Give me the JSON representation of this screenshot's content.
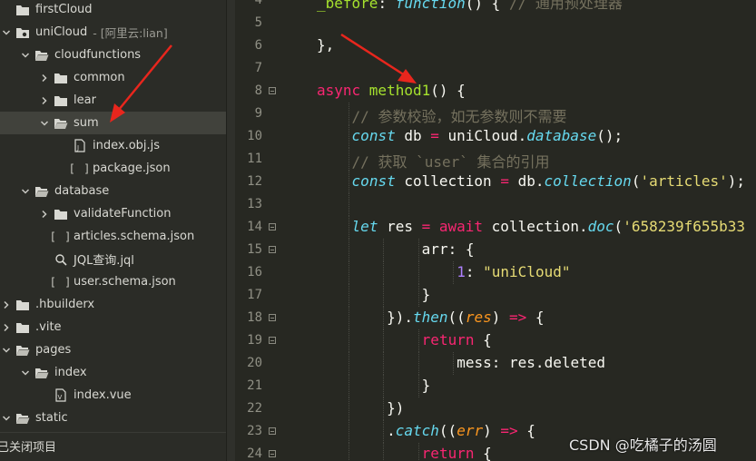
{
  "sidebar": {
    "tree": [
      {
        "label": "firstCloud",
        "sub": "",
        "depth": 0,
        "twisty": "none",
        "icon": "project-icon",
        "selected": false
      },
      {
        "label": "uniCloud",
        "sub": "- [阿里云:lian]",
        "depth": 0,
        "twisty": "down",
        "icon": "cloud-folder-icon",
        "selected": false
      },
      {
        "label": "cloudfunctions",
        "sub": "",
        "depth": 1,
        "twisty": "down",
        "icon": "folder-open-icon",
        "selected": false
      },
      {
        "label": "common",
        "sub": "",
        "depth": 2,
        "twisty": "right",
        "icon": "folder-icon",
        "selected": false
      },
      {
        "label": "lear",
        "sub": "",
        "depth": 2,
        "twisty": "right",
        "icon": "folder-icon",
        "selected": false
      },
      {
        "label": "sum",
        "sub": "",
        "depth": 2,
        "twisty": "down",
        "icon": "folder-open-icon",
        "selected": true
      },
      {
        "label": "index.obj.js",
        "sub": "",
        "depth": 3,
        "twisty": "none",
        "icon": "js-file-icon",
        "selected": false
      },
      {
        "label": "package.json",
        "sub": "",
        "depth": 3,
        "twisty": "none",
        "icon": "json-file-icon",
        "selected": false
      },
      {
        "label": "database",
        "sub": "",
        "depth": 1,
        "twisty": "down",
        "icon": "folder-open-icon",
        "selected": false
      },
      {
        "label": "validateFunction",
        "sub": "",
        "depth": 2,
        "twisty": "right",
        "icon": "folder-icon",
        "selected": false
      },
      {
        "label": "articles.schema.json",
        "sub": "",
        "depth": 2,
        "twisty": "none",
        "icon": "json-file-icon",
        "selected": false
      },
      {
        "label": "JQL查询.jql",
        "sub": "",
        "depth": 2,
        "twisty": "none",
        "icon": "jql-file-icon",
        "selected": false
      },
      {
        "label": "user.schema.json",
        "sub": "",
        "depth": 2,
        "twisty": "none",
        "icon": "json-file-icon",
        "selected": false
      },
      {
        "label": ".hbuilderx",
        "sub": "",
        "depth": 0,
        "twisty": "right",
        "icon": "folder-icon",
        "selected": false
      },
      {
        "label": ".vite",
        "sub": "",
        "depth": 0,
        "twisty": "right",
        "icon": "folder-icon",
        "selected": false
      },
      {
        "label": "pages",
        "sub": "",
        "depth": 0,
        "twisty": "down",
        "icon": "folder-open-icon",
        "selected": false
      },
      {
        "label": "index",
        "sub": "",
        "depth": 1,
        "twisty": "down",
        "icon": "folder-open-icon",
        "selected": false
      },
      {
        "label": "index.vue",
        "sub": "",
        "depth": 2,
        "twisty": "none",
        "icon": "vue-file-icon",
        "selected": false
      },
      {
        "label": "static",
        "sub": "",
        "depth": 0,
        "twisty": "down",
        "icon": "folder-open-icon",
        "selected": false
      }
    ],
    "closed_projects": "已关闭项目"
  },
  "editor": {
    "lines": [
      {
        "n": "4",
        "fold": false,
        "indent": 1,
        "tokens": [
          [
            "fn",
            "_before"
          ],
          [
            "pl",
            ": "
          ],
          [
            "kwi",
            "function"
          ],
          [
            "pl",
            "() { "
          ],
          [
            "cm",
            "// 通用预处理器"
          ]
        ]
      },
      {
        "n": "5",
        "fold": false,
        "indent": 1,
        "tokens": []
      },
      {
        "n": "6",
        "fold": false,
        "indent": 1,
        "tokens": [
          [
            "pl",
            "},"
          ]
        ]
      },
      {
        "n": "7",
        "fold": false,
        "indent": 1,
        "tokens": []
      },
      {
        "n": "8",
        "fold": true,
        "indent": 1,
        "tokens": [
          [
            "kw",
            "async "
          ],
          [
            "fn",
            "method1"
          ],
          [
            "pl",
            "() {"
          ]
        ]
      },
      {
        "n": "9",
        "fold": false,
        "indent": 2,
        "tokens": [
          [
            "cm",
            "// 参数校验，如无参数则不需要"
          ]
        ]
      },
      {
        "n": "10",
        "fold": false,
        "indent": 2,
        "tokens": [
          [
            "kwi",
            "const "
          ],
          [
            "pl",
            "db "
          ],
          [
            "kw",
            "= "
          ],
          [
            "pl",
            "uniCloud."
          ],
          [
            "kwi",
            "database"
          ],
          [
            "pl",
            "();"
          ]
        ]
      },
      {
        "n": "11",
        "fold": false,
        "indent": 2,
        "tokens": [
          [
            "cm",
            "// 获取 `user` 集合的引用"
          ]
        ]
      },
      {
        "n": "12",
        "fold": false,
        "indent": 2,
        "tokens": [
          [
            "kwi",
            "const "
          ],
          [
            "pl",
            "collection "
          ],
          [
            "kw",
            "= "
          ],
          [
            "pl",
            "db."
          ],
          [
            "kwi",
            "collection"
          ],
          [
            "pl",
            "("
          ],
          [
            "st",
            "'articles'"
          ],
          [
            "pl",
            ");"
          ]
        ]
      },
      {
        "n": "13",
        "fold": false,
        "indent": 2,
        "tokens": []
      },
      {
        "n": "14",
        "fold": true,
        "indent": 2,
        "tokens": [
          [
            "kwi",
            "let "
          ],
          [
            "pl",
            "res "
          ],
          [
            "kw",
            "= await "
          ],
          [
            "pl",
            "collection."
          ],
          [
            "kwi",
            "doc"
          ],
          [
            "pl",
            "("
          ],
          [
            "st",
            "'658239f655b33"
          ]
        ]
      },
      {
        "n": "15",
        "fold": true,
        "indent": 4,
        "tokens": [
          [
            "pl",
            "arr: {"
          ]
        ]
      },
      {
        "n": "16",
        "fold": false,
        "indent": 5,
        "tokens": [
          [
            "nm",
            "1"
          ],
          [
            "pl",
            ": "
          ],
          [
            "st",
            "\"uniCloud\""
          ]
        ]
      },
      {
        "n": "17",
        "fold": false,
        "indent": 4,
        "tokens": [
          [
            "pl",
            "}"
          ]
        ]
      },
      {
        "n": "18",
        "fold": true,
        "indent": 3,
        "tokens": [
          [
            "pl",
            "})."
          ],
          [
            "kwi",
            "then"
          ],
          [
            "pl",
            "(("
          ],
          [
            "pm",
            "res"
          ],
          [
            "pl",
            ") "
          ],
          [
            "kw",
            "=> "
          ],
          [
            "pl",
            "{"
          ]
        ]
      },
      {
        "n": "19",
        "fold": true,
        "indent": 4,
        "tokens": [
          [
            "kw",
            "return "
          ],
          [
            "pl",
            "{"
          ]
        ]
      },
      {
        "n": "20",
        "fold": false,
        "indent": 5,
        "tokens": [
          [
            "pl",
            "mess: res.deleted"
          ]
        ]
      },
      {
        "n": "21",
        "fold": false,
        "indent": 4,
        "tokens": [
          [
            "pl",
            "}"
          ]
        ]
      },
      {
        "n": "22",
        "fold": false,
        "indent": 3,
        "tokens": [
          [
            "pl",
            "})"
          ]
        ]
      },
      {
        "n": "23",
        "fold": true,
        "indent": 3,
        "tokens": [
          [
            "pl",
            "."
          ],
          [
            "kwi",
            "catch"
          ],
          [
            "pl",
            "(("
          ],
          [
            "pm",
            "err"
          ],
          [
            "pl",
            ") "
          ],
          [
            "kw",
            "=> "
          ],
          [
            "pl",
            "{"
          ]
        ]
      },
      {
        "n": "24",
        "fold": true,
        "indent": 4,
        "tokens": [
          [
            "kw",
            "return "
          ],
          [
            "pl",
            "{"
          ]
        ]
      }
    ]
  },
  "watermark": "CSDN @吃橘子的汤圆",
  "colors": {
    "arrow": "#e8261d",
    "selected_row": "#41423c",
    "background": "#272822"
  }
}
